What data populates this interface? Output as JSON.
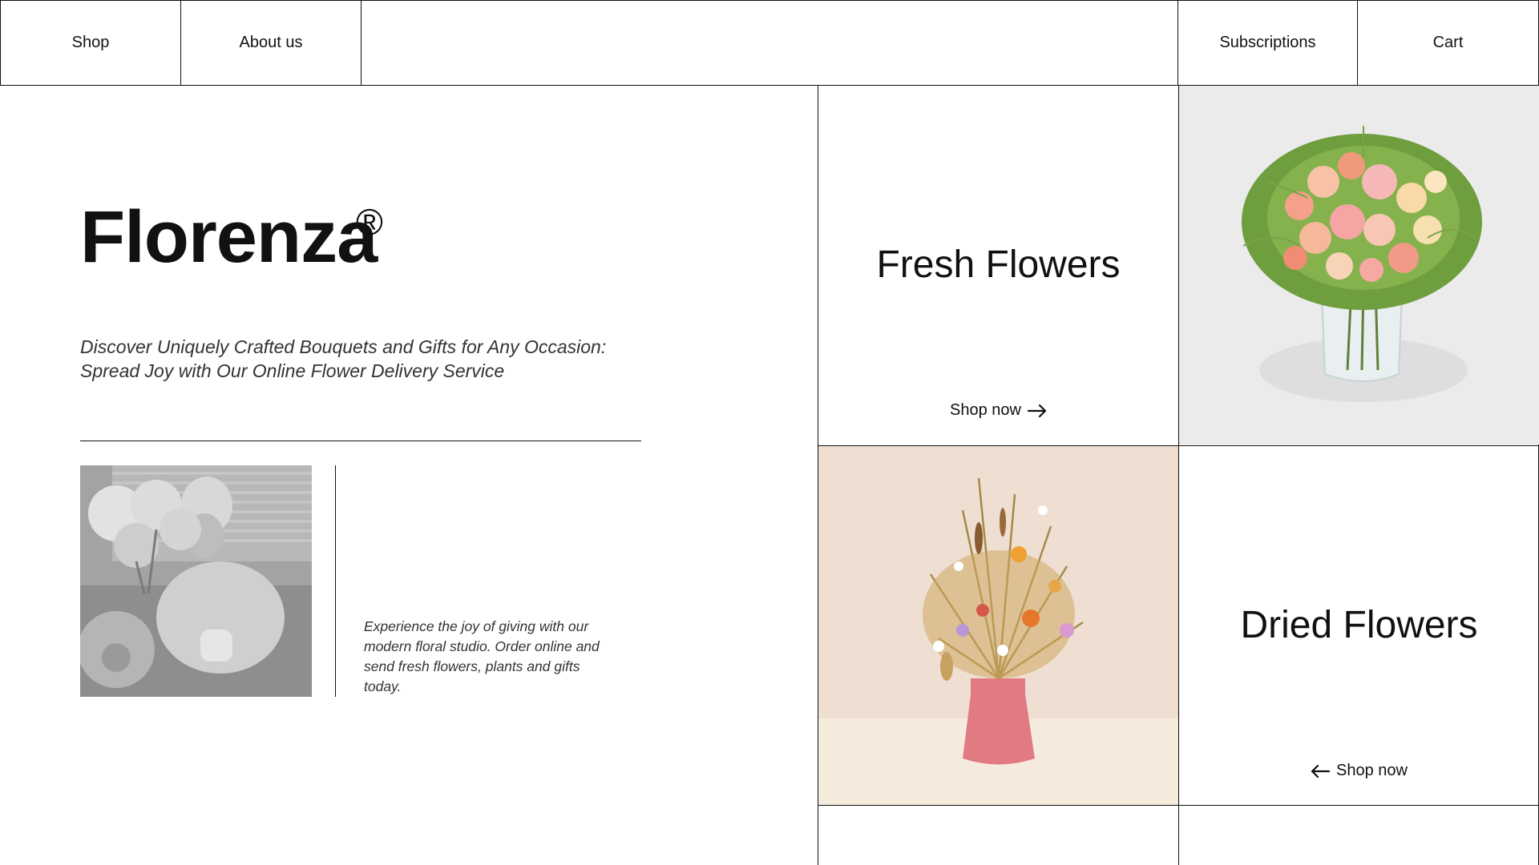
{
  "nav": {
    "shop": "Shop",
    "about": "About us",
    "subscriptions": "Subscriptions",
    "cart": "Cart"
  },
  "hero": {
    "brand": "Florenza",
    "registered_mark": "®",
    "tagline": "Discover Uniquely Crafted Bouquets and Gifts for Any Occasion: Spread Joy with Our Online Flower Delivery Service",
    "blurb": "Experience the joy of giving with our modern floral studio. Order online and send fresh flowers, plants and gifts today."
  },
  "tiles": {
    "fresh": {
      "title": "Fresh Flowers",
      "cta": "Shop now",
      "arrow_icon": "arrow-right-icon"
    },
    "dried": {
      "title": "Dried Flowers",
      "cta": "Shop now",
      "arrow_icon": "arrow-left-icon"
    }
  },
  "colors": {
    "ink": "#111111",
    "muted_text": "#333333",
    "photo_bg_light": "#ebebeb",
    "photo_bg_warm": "#efe3d8"
  }
}
